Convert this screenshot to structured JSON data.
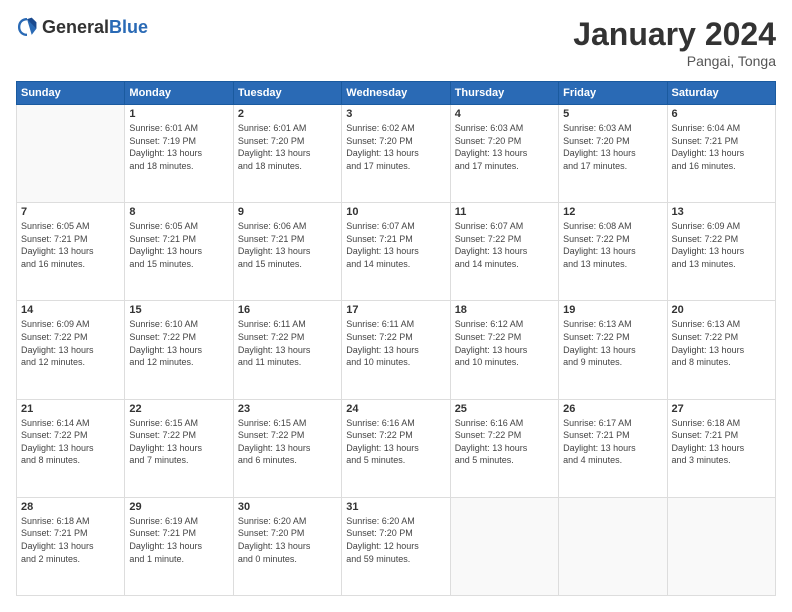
{
  "header": {
    "logo_general": "General",
    "logo_blue": "Blue",
    "month_title": "January 2024",
    "subtitle": "Pangai, Tonga"
  },
  "days_of_week": [
    "Sunday",
    "Monday",
    "Tuesday",
    "Wednesday",
    "Thursday",
    "Friday",
    "Saturday"
  ],
  "weeks": [
    [
      {
        "num": "",
        "info": ""
      },
      {
        "num": "1",
        "info": "Sunrise: 6:01 AM\nSunset: 7:19 PM\nDaylight: 13 hours\nand 18 minutes."
      },
      {
        "num": "2",
        "info": "Sunrise: 6:01 AM\nSunset: 7:20 PM\nDaylight: 13 hours\nand 18 minutes."
      },
      {
        "num": "3",
        "info": "Sunrise: 6:02 AM\nSunset: 7:20 PM\nDaylight: 13 hours\nand 17 minutes."
      },
      {
        "num": "4",
        "info": "Sunrise: 6:03 AM\nSunset: 7:20 PM\nDaylight: 13 hours\nand 17 minutes."
      },
      {
        "num": "5",
        "info": "Sunrise: 6:03 AM\nSunset: 7:20 PM\nDaylight: 13 hours\nand 17 minutes."
      },
      {
        "num": "6",
        "info": "Sunrise: 6:04 AM\nSunset: 7:21 PM\nDaylight: 13 hours\nand 16 minutes."
      }
    ],
    [
      {
        "num": "7",
        "info": "Sunrise: 6:05 AM\nSunset: 7:21 PM\nDaylight: 13 hours\nand 16 minutes."
      },
      {
        "num": "8",
        "info": "Sunrise: 6:05 AM\nSunset: 7:21 PM\nDaylight: 13 hours\nand 15 minutes."
      },
      {
        "num": "9",
        "info": "Sunrise: 6:06 AM\nSunset: 7:21 PM\nDaylight: 13 hours\nand 15 minutes."
      },
      {
        "num": "10",
        "info": "Sunrise: 6:07 AM\nSunset: 7:21 PM\nDaylight: 13 hours\nand 14 minutes."
      },
      {
        "num": "11",
        "info": "Sunrise: 6:07 AM\nSunset: 7:22 PM\nDaylight: 13 hours\nand 14 minutes."
      },
      {
        "num": "12",
        "info": "Sunrise: 6:08 AM\nSunset: 7:22 PM\nDaylight: 13 hours\nand 13 minutes."
      },
      {
        "num": "13",
        "info": "Sunrise: 6:09 AM\nSunset: 7:22 PM\nDaylight: 13 hours\nand 13 minutes."
      }
    ],
    [
      {
        "num": "14",
        "info": "Sunrise: 6:09 AM\nSunset: 7:22 PM\nDaylight: 13 hours\nand 12 minutes."
      },
      {
        "num": "15",
        "info": "Sunrise: 6:10 AM\nSunset: 7:22 PM\nDaylight: 13 hours\nand 12 minutes."
      },
      {
        "num": "16",
        "info": "Sunrise: 6:11 AM\nSunset: 7:22 PM\nDaylight: 13 hours\nand 11 minutes."
      },
      {
        "num": "17",
        "info": "Sunrise: 6:11 AM\nSunset: 7:22 PM\nDaylight: 13 hours\nand 10 minutes."
      },
      {
        "num": "18",
        "info": "Sunrise: 6:12 AM\nSunset: 7:22 PM\nDaylight: 13 hours\nand 10 minutes."
      },
      {
        "num": "19",
        "info": "Sunrise: 6:13 AM\nSunset: 7:22 PM\nDaylight: 13 hours\nand 9 minutes."
      },
      {
        "num": "20",
        "info": "Sunrise: 6:13 AM\nSunset: 7:22 PM\nDaylight: 13 hours\nand 8 minutes."
      }
    ],
    [
      {
        "num": "21",
        "info": "Sunrise: 6:14 AM\nSunset: 7:22 PM\nDaylight: 13 hours\nand 8 minutes."
      },
      {
        "num": "22",
        "info": "Sunrise: 6:15 AM\nSunset: 7:22 PM\nDaylight: 13 hours\nand 7 minutes."
      },
      {
        "num": "23",
        "info": "Sunrise: 6:15 AM\nSunset: 7:22 PM\nDaylight: 13 hours\nand 6 minutes."
      },
      {
        "num": "24",
        "info": "Sunrise: 6:16 AM\nSunset: 7:22 PM\nDaylight: 13 hours\nand 5 minutes."
      },
      {
        "num": "25",
        "info": "Sunrise: 6:16 AM\nSunset: 7:22 PM\nDaylight: 13 hours\nand 5 minutes."
      },
      {
        "num": "26",
        "info": "Sunrise: 6:17 AM\nSunset: 7:21 PM\nDaylight: 13 hours\nand 4 minutes."
      },
      {
        "num": "27",
        "info": "Sunrise: 6:18 AM\nSunset: 7:21 PM\nDaylight: 13 hours\nand 3 minutes."
      }
    ],
    [
      {
        "num": "28",
        "info": "Sunrise: 6:18 AM\nSunset: 7:21 PM\nDaylight: 13 hours\nand 2 minutes."
      },
      {
        "num": "29",
        "info": "Sunrise: 6:19 AM\nSunset: 7:21 PM\nDaylight: 13 hours\nand 1 minute."
      },
      {
        "num": "30",
        "info": "Sunrise: 6:20 AM\nSunset: 7:20 PM\nDaylight: 13 hours\nand 0 minutes."
      },
      {
        "num": "31",
        "info": "Sunrise: 6:20 AM\nSunset: 7:20 PM\nDaylight: 12 hours\nand 59 minutes."
      },
      {
        "num": "",
        "info": ""
      },
      {
        "num": "",
        "info": ""
      },
      {
        "num": "",
        "info": ""
      }
    ]
  ]
}
